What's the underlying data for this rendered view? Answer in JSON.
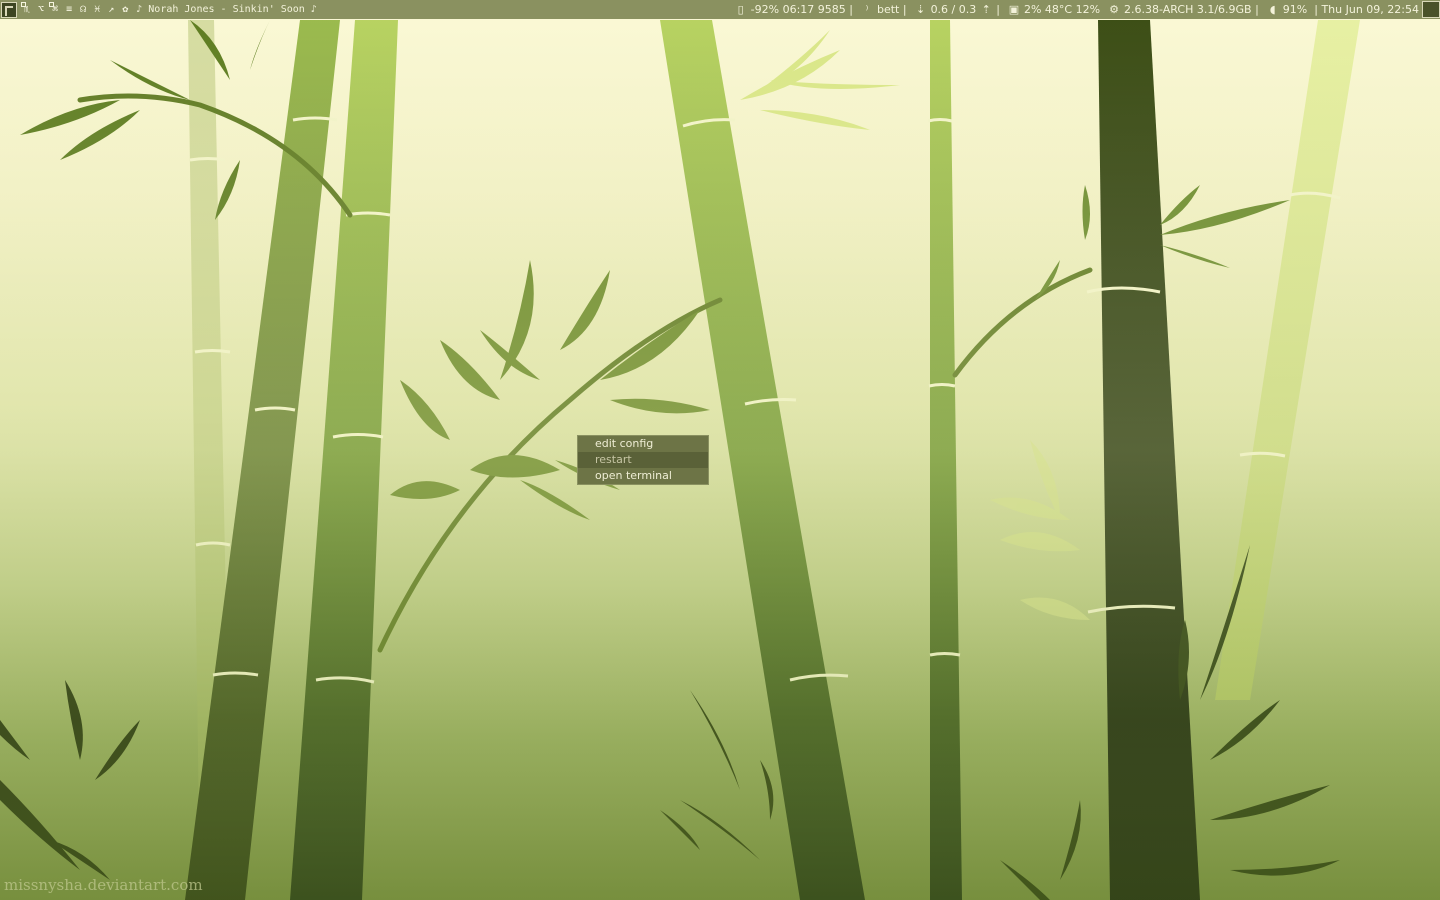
{
  "topbar": {
    "tags": [
      "♏",
      "⌥",
      "⌘",
      "≡",
      "☊",
      "♓",
      "↗",
      "✿"
    ],
    "now_playing": "♪ Norah Jones - Sinkin' Soon ♪",
    "battery": "-92% 06:17 9585 |",
    "wifi": "bett |",
    "network": "0.6 / 0.3",
    "net_sep": "|",
    "cpu": "2% 48°C 12%",
    "system": "2.6.38-ARCH 3.1/6.9GB |",
    "volume": "91%",
    "datetime": "| Thu Jun 09, 22:54"
  },
  "context_menu": {
    "items": [
      "edit config",
      "restart",
      "open terminal"
    ]
  },
  "watermark": "missnysha.deviantart.com",
  "colors": {
    "bar": "#8a9160",
    "menu": "#6d7446",
    "menu_active": "#5a6138",
    "dark_bamboo": "#1e2a0c",
    "light_bamboo": "#c9dc6a"
  }
}
